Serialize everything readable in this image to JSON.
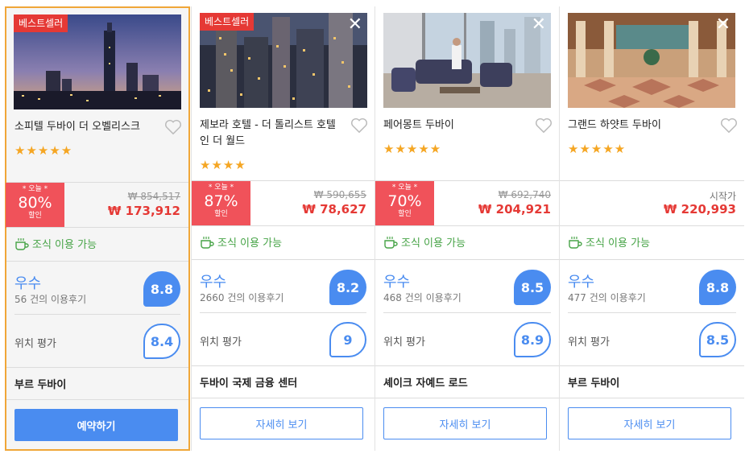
{
  "hotels": [
    {
      "badge": "베스트셀러",
      "name": "소피텔 두바이 더 오벨리스크",
      "stars": "★★★★★",
      "deal_today": "* 오늘 *",
      "deal_pct": "80%",
      "deal_off": "할인",
      "original_price": "₩ 854,517",
      "price": "₩ 173,912",
      "breakfast": "조식 이용 가능",
      "rating_label": "우수",
      "review_count": "56 건의 이용후기",
      "score": "8.8",
      "location_label": "위치 평가",
      "location_score": "8.4",
      "area": "부르 두바이",
      "button": "예약하기"
    },
    {
      "badge": "베스트셀러",
      "name": "제보라 호텔 - 더 톨리스트 호텔 인 더 월드",
      "stars": "★★★★",
      "deal_today": "* 오늘 *",
      "deal_pct": "87%",
      "deal_off": "할인",
      "original_price": "₩ 590,655",
      "price": "₩ 78,627",
      "breakfast": "조식 이용 가능",
      "rating_label": "우수",
      "review_count": "2660 건의 이용후기",
      "score": "8.2",
      "location_label": "위치 평가",
      "location_score": "9",
      "area": "두바이 국제 금융 센터",
      "button": "자세히 보기"
    },
    {
      "name": "페어몽트 두바이",
      "stars": "★★★★★",
      "deal_today": "* 오늘 *",
      "deal_pct": "70%",
      "deal_off": "할인",
      "original_price": "₩ 692,740",
      "price": "₩ 204,921",
      "breakfast": "조식 이용 가능",
      "rating_label": "우수",
      "review_count": "468 건의 이용후기",
      "score": "8.5",
      "location_label": "위치 평가",
      "location_score": "8.9",
      "area": "셰이크 자예드 로드",
      "button": "자세히 보기"
    },
    {
      "name": "그랜드 하얏트 두바이",
      "stars": "★★★★★",
      "from_label": "시작가",
      "price": "₩ 220,993",
      "breakfast": "조식 이용 가능",
      "rating_label": "우수",
      "review_count": "477 건의 이용후기",
      "score": "8.8",
      "location_label": "위치 평가",
      "location_score": "8.5",
      "area": "부르 두바이",
      "button": "자세히 보기"
    }
  ],
  "colors": {
    "accent": "#4a8cf0",
    "price": "#e53935",
    "deal": "#f0525a",
    "stars": "#f5a623",
    "breakfast": "#46a346",
    "selected_border": "#f0a638"
  },
  "icons": [
    "heart-icon",
    "close-icon",
    "coffee-cup-icon",
    "star-icon"
  ]
}
